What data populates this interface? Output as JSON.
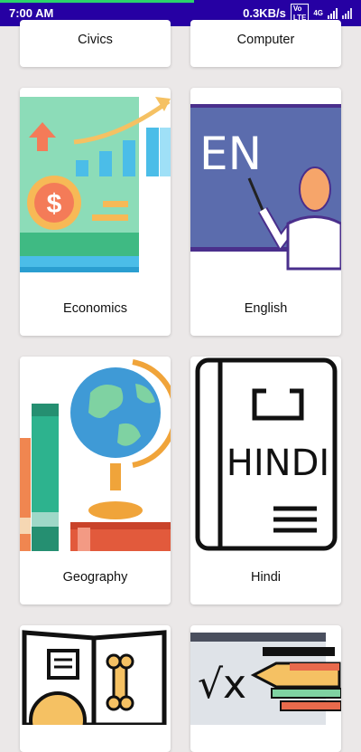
{
  "status_bar": {
    "time": "7:00 AM",
    "speed": "0.3KB/s",
    "volte": "Vo LTE",
    "network": "4G",
    "colors": {
      "bar": "#2600a3",
      "progress": "#2bd36b"
    },
    "icons": [
      "volte-icon",
      "signal-icon",
      "signal-icon"
    ]
  },
  "subjects": [
    {
      "name": "Civics",
      "icon": "civics-icon"
    },
    {
      "name": "Computer",
      "icon": "computer-icon"
    },
    {
      "name": "Economics",
      "icon": "economics-icon"
    },
    {
      "name": "English",
      "icon": "english-teacher-icon",
      "board_text": "EN"
    },
    {
      "name": "Geography",
      "icon": "globe-books-icon"
    },
    {
      "name": "Hindi",
      "icon": "hindi-book-icon",
      "book_text": "HINDI"
    },
    {
      "name": "",
      "icon": "open-book-bone-icon"
    },
    {
      "name": "",
      "icon": "math-pencil-icon"
    }
  ]
}
